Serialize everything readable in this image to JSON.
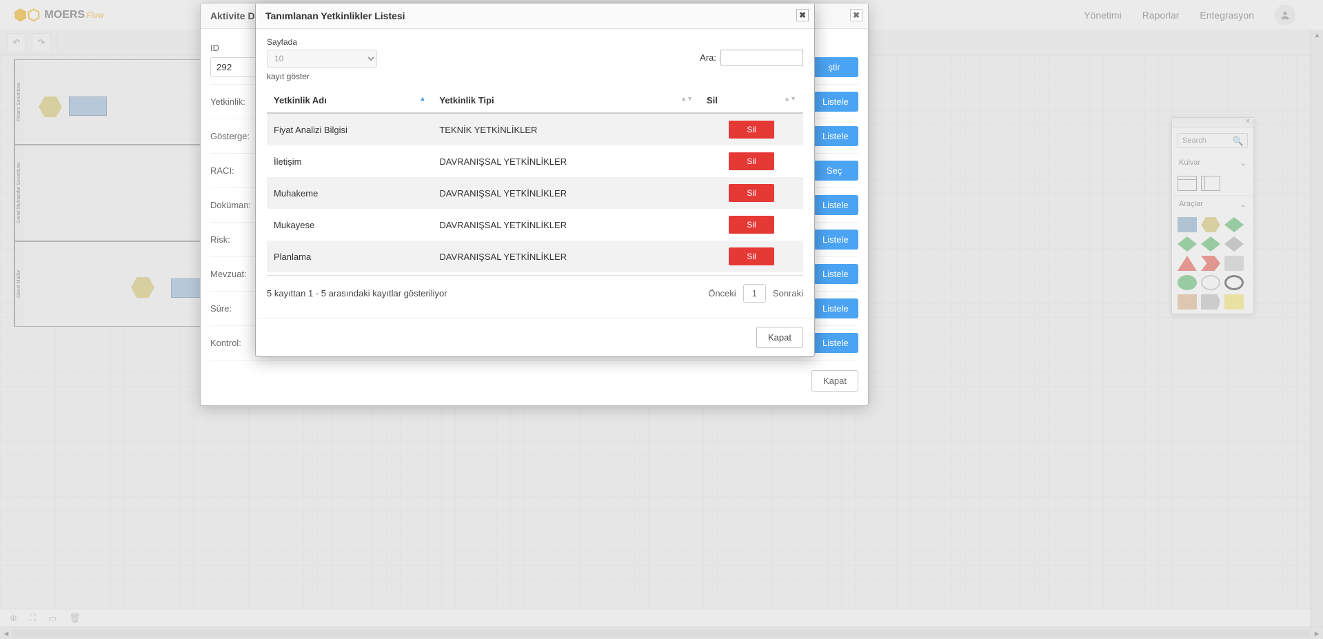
{
  "header": {
    "logo_main": "MOERS",
    "logo_sub": "Flow",
    "nav": [
      {
        "label": "Yönetimi"
      },
      {
        "label": "Raporlar"
      },
      {
        "label": "Entegrasyon"
      }
    ]
  },
  "shapes_panel": {
    "search_placeholder": "Search",
    "section1": "Kulvar",
    "section2": "Araçlar"
  },
  "modal_back": {
    "title": "Aktivite De",
    "rows": {
      "id_label": "ID",
      "id_value": "292",
      "yetkinlik": "Yetkinlik:",
      "gosterge": "Gösterge:",
      "raci": "RACI:",
      "dokuman": "Doküman:",
      "risk": "Risk:",
      "mevzuat": "Mevzuat:",
      "sure": "Süre:",
      "kontrol": "Kontrol:"
    },
    "change_btn": "ştir",
    "list_btn": "Listele",
    "sec_btn": "Seç",
    "close_btn": "Kapat"
  },
  "modal_front": {
    "title": "Tanımlanan Yetkinlikler Listesi",
    "page_label": "Sayfada",
    "page_size": "10",
    "records_hint": "kayıt göster",
    "search_label": "Ara:",
    "col_name": "Yetkinlik Adı",
    "col_type": "Yetkinlik Tipi",
    "col_del": "Sil",
    "rows": [
      {
        "name": "Fiyat Analizi Bilgisi",
        "type": "TEKNİK YETKİNLİKLER"
      },
      {
        "name": "İletişim",
        "type": "DAVRANIŞSAL YETKİNLİKLER"
      },
      {
        "name": "Muhakeme",
        "type": "DAVRANIŞSAL YETKİNLİKLER"
      },
      {
        "name": "Mukayese",
        "type": "DAVRANIŞSAL YETKİNLİKLER"
      },
      {
        "name": "Planlama",
        "type": "DAVRANIŞSAL YETKİNLİKLER"
      }
    ],
    "delete_btn": "Sil",
    "footer_info": "5 kayıttan 1 - 5 arasındaki kayıtlar gösteriliyor",
    "prev": "Önceki",
    "page_num": "1",
    "next": "Sonraki",
    "close_btn": "Kapat"
  }
}
